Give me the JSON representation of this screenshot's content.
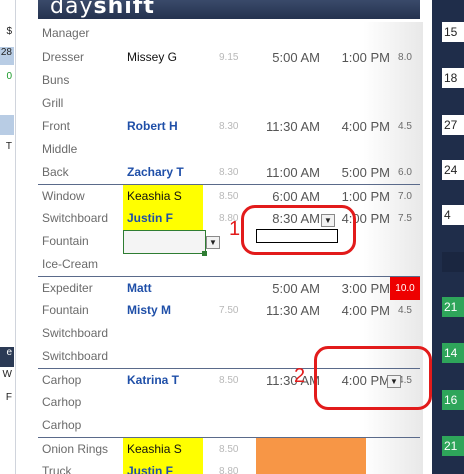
{
  "app": {
    "title_prefix": "day",
    "title_bold": "shift"
  },
  "left_panel": {
    "cells": [
      {
        "text": "$",
        "style": "plain"
      },
      {
        "text": "28",
        "style": "blue"
      },
      {
        "text": "0",
        "style": "green"
      },
      {
        "text": "T",
        "style": "plain"
      },
      {
        "text": "e",
        "style": "navy"
      },
      {
        "text": "W",
        "style": "plain"
      },
      {
        "text": "F",
        "style": "plain"
      }
    ]
  },
  "right_panel": {
    "values": [
      "15",
      "18",
      "27",
      "24",
      "4",
      "21",
      "14",
      "16",
      "21"
    ]
  },
  "rows": [
    {
      "role": "Manager",
      "name": "",
      "rate": "",
      "start": "",
      "end": "",
      "hours": "",
      "name_style": "",
      "hours_style": ""
    },
    {
      "role": "Dresser",
      "name": "Missey G",
      "rate": "9.15",
      "start": "5:00 AM",
      "end": "1:00 PM",
      "hours": "8.0",
      "name_style": "black",
      "hours_style": ""
    },
    {
      "role": "Buns",
      "name": "",
      "rate": "",
      "start": "",
      "end": "",
      "hours": "",
      "name_style": "",
      "hours_style": ""
    },
    {
      "role": "Grill",
      "name": "",
      "rate": "",
      "start": "",
      "end": "",
      "hours": "",
      "name_style": "",
      "hours_style": ""
    },
    {
      "role": "Front",
      "name": "Robert H",
      "rate": "8.30",
      "start": "11:30 AM",
      "end": "4:00 PM",
      "hours": "4.5",
      "name_style": "blue",
      "hours_style": ""
    },
    {
      "role": "Middle",
      "name": "",
      "rate": "",
      "start": "",
      "end": "",
      "hours": "",
      "name_style": "",
      "hours_style": ""
    },
    {
      "role": "Back",
      "name": "Zachary T",
      "rate": "8.30",
      "start": "11:00 AM",
      "end": "5:00 PM",
      "hours": "6.0",
      "name_style": "blue",
      "hours_style": ""
    },
    {
      "role": "Window",
      "name": "Keashia S",
      "rate": "8.50",
      "start": "6:00 AM",
      "end": "1:00 PM",
      "hours": "7.0",
      "name_style": "yellow",
      "hours_style": ""
    },
    {
      "role": "Switchboard",
      "name": "Justin F",
      "rate": "8.80",
      "start": "8:30 AM",
      "end": "4:00 PM",
      "hours": "7.5",
      "name_style": "yellow-blue",
      "hours_style": ""
    },
    {
      "role": "Fountain",
      "name": "",
      "rate": "",
      "start": "",
      "end": "",
      "hours": "",
      "name_style": "",
      "hours_style": ""
    },
    {
      "role": "Ice-Cream",
      "name": "",
      "rate": "",
      "start": "",
      "end": "",
      "hours": "",
      "name_style": "",
      "hours_style": ""
    },
    {
      "role": "Expediter",
      "name": "Matt",
      "rate": "",
      "start": "5:00 AM",
      "end": "3:00 PM",
      "hours": "10.0",
      "name_style": "blue",
      "hours_style": "red"
    },
    {
      "role": "Fountain",
      "name": "Misty M",
      "rate": "7.50",
      "start": "11:30 AM",
      "end": "4:00 PM",
      "hours": "4.5",
      "name_style": "blue",
      "hours_style": ""
    },
    {
      "role": "Switchboard",
      "name": "",
      "rate": "",
      "start": "",
      "end": "",
      "hours": "",
      "name_style": "",
      "hours_style": ""
    },
    {
      "role": "Switchboard",
      "name": "",
      "rate": "",
      "start": "",
      "end": "",
      "hours": "",
      "name_style": "",
      "hours_style": ""
    },
    {
      "role": "Carhop",
      "name": "Katrina T",
      "rate": "8.50",
      "start": "11:30 AM",
      "end": "4:00 PM",
      "hours": "4.5",
      "name_style": "blue",
      "hours_style": ""
    },
    {
      "role": "Carhop",
      "name": "",
      "rate": "",
      "start": "",
      "end": "",
      "hours": "",
      "name_style": "",
      "hours_style": ""
    },
    {
      "role": "Carhop",
      "name": "",
      "rate": "",
      "start": "",
      "end": "",
      "hours": "",
      "name_style": "",
      "hours_style": ""
    },
    {
      "role": "Onion Rings",
      "name": "Keashia S",
      "rate": "8.50",
      "start": "",
      "end": "",
      "hours": "",
      "name_style": "yellow",
      "hours_style": "",
      "orange": true
    },
    {
      "role": "Truck",
      "name": "Justin F",
      "rate": "8.80",
      "start": "",
      "end": "",
      "hours": "",
      "name_style": "yellow-blue",
      "hours_style": "",
      "orange": true
    }
  ],
  "annotations": [
    "1",
    "2"
  ],
  "colors": {
    "accent_red": "#e21b1b",
    "highlight_yellow": "#ffff00",
    "header_navy": "#24324f",
    "name_blue": "#1f4fa8"
  }
}
